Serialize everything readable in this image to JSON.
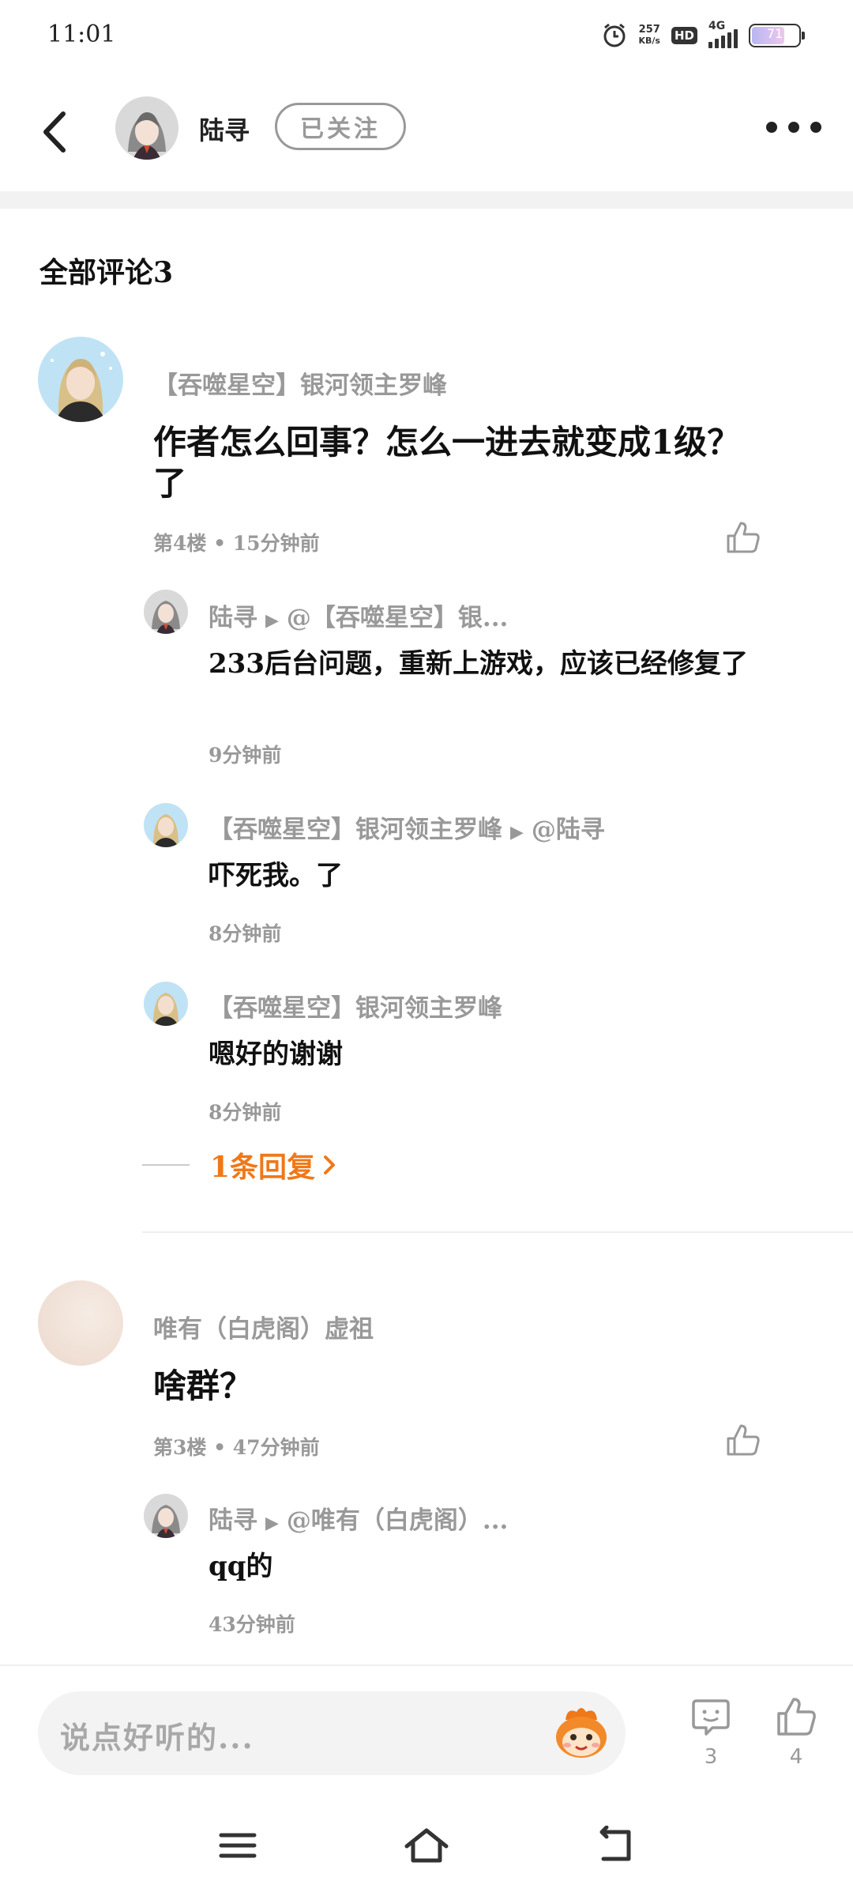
{
  "status_bar": {
    "time": "11:01",
    "net_speed_value": "257",
    "net_speed_unit": "KB/s",
    "hd_label": "HD",
    "network_type": "4G",
    "battery_percent": "71"
  },
  "header": {
    "username": "陆寻",
    "follow_label": "已关注"
  },
  "comments_title": "全部评论3",
  "comments": [
    {
      "author": "【吞噬星空】银河领主罗峰",
      "text": "作者怎么回事？怎么一进去就变成1级？了",
      "floor_time": "第4楼 • 15分钟前",
      "replies": [
        {
          "author": "陆寻",
          "target": "@【吞噬星空】银...",
          "text": "233后台问题，重新上游戏，应该已经修复了",
          "time": "9分钟前"
        },
        {
          "author": "【吞噬星空】银河领主罗峰",
          "target": "@陆寻",
          "text": "吓死我。了",
          "time": "8分钟前"
        },
        {
          "author": "【吞噬星空】银河领主罗峰",
          "target": "",
          "text": "嗯好的谢谢",
          "time": "8分钟前"
        }
      ],
      "more_replies_label": "1条回复"
    },
    {
      "author": "唯有（白虎阁）虚祖",
      "text": "啥群？",
      "floor_time": "第3楼 • 47分钟前",
      "replies": [
        {
          "author": "陆寻",
          "target": "@唯有（白虎阁）...",
          "text": "qq的",
          "time": "43分钟前"
        }
      ]
    }
  ],
  "bottom_bar": {
    "input_placeholder": "说点好听的...",
    "comment_count": "3",
    "like_count": "4"
  },
  "colors": {
    "accent": "#f07818",
    "muted_text": "#999999",
    "divider": "#f2f2f2"
  },
  "icons": [
    "alarm-icon",
    "back-arrow-icon",
    "more-dots-icon",
    "thumbs-up-icon",
    "chevron-right-icon",
    "sticker-icon",
    "comment-bubble-icon",
    "menu-icon",
    "home-icon",
    "back-nav-icon"
  ]
}
